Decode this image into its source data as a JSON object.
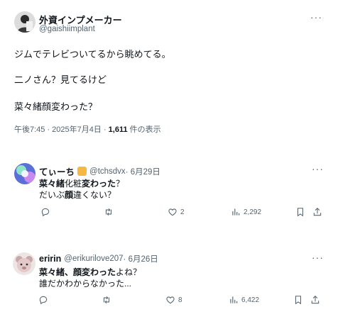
{
  "post": {
    "author_name": "外資インプメーカー",
    "author_handle": "@gaishiimplant",
    "lines": [
      "ジムでテレビついてるから眺めてる。",
      "二ノさん？見てるけど",
      "菜々緒顔変わった？"
    ],
    "time": "午後7:45 · 2025年7月4日 · ",
    "views": "1,611",
    "views_label": " 件の表示"
  },
  "replies": [
    {
      "name": "てぃーち",
      "badge_icon": "hand-emoji-icon",
      "handle": "@tchsdvx",
      "date": " · 6月29日",
      "line1_bold_a": "菜々緒",
      "line1_plain": "化粧",
      "line1_bold_b": "変わった",
      "line1_tail": "？",
      "line2_pre": "だいぶ",
      "line2_bold": "顔",
      "line2_post": "違くない？",
      "actions": {
        "likes": "2",
        "views": "2,292"
      }
    },
    {
      "name": "eririn",
      "handle": "@erikurilove207",
      "date": " · 6月26日",
      "line1_bold": "菜々緒、顔変わった",
      "line1_tail": "よね？",
      "line2": "誰だかわからなかった...",
      "actions": {
        "likes": "8",
        "views": "6,422"
      }
    }
  ],
  "icons": {
    "reply": "reply-icon",
    "repost": "repost-icon",
    "like": "heart-icon",
    "views": "views-chart-icon",
    "bookmark": "bookmark-icon",
    "share": "share-icon",
    "more": "more-icon"
  },
  "more_label": "···"
}
